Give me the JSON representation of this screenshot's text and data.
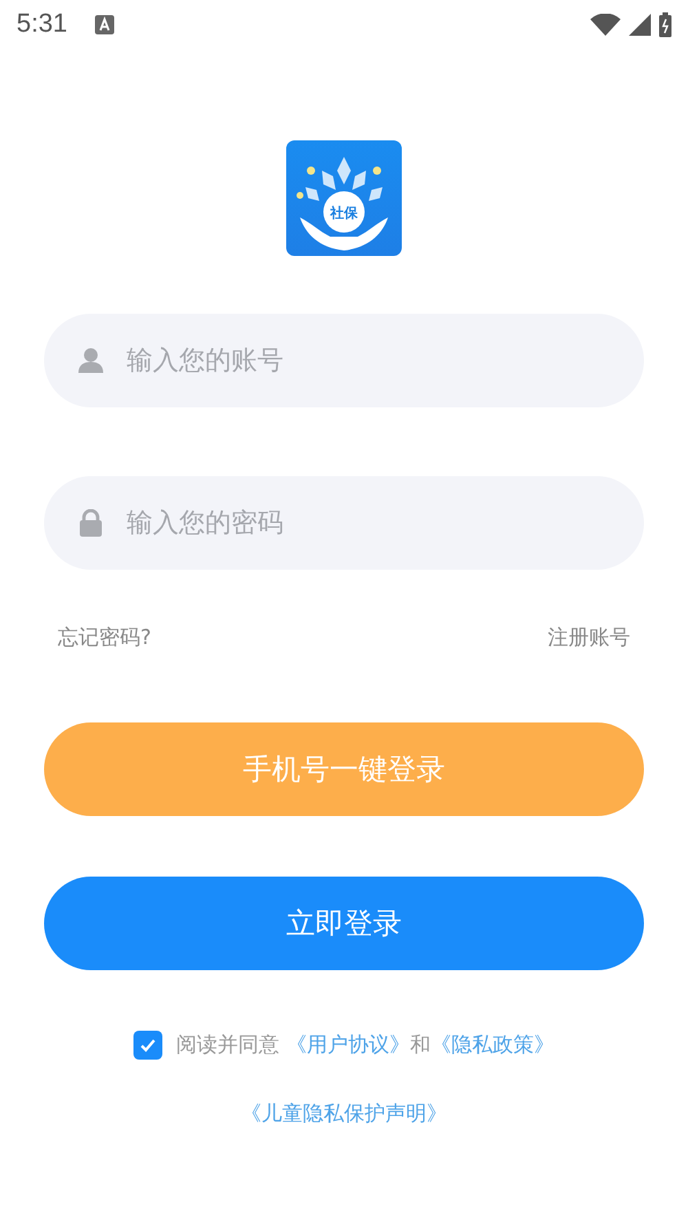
{
  "status_bar": {
    "time": "5:31"
  },
  "logo": {
    "text": "社保"
  },
  "fields": [
    {
      "kind": "user",
      "placeholder": "输入您的账号"
    },
    {
      "kind": "lock",
      "placeholder": "输入您的密码"
    }
  ],
  "links": {
    "forgot": "忘记密码?",
    "register": "注册账号"
  },
  "buttons": [
    {
      "kind": "phone",
      "label": "手机号一键登录"
    },
    {
      "kind": "login",
      "label": "立即登录"
    }
  ],
  "agreement": {
    "checked": true,
    "prefix": "阅读并同意 ",
    "user_agreement": "《用户协议》",
    "joiner": "和",
    "privacy": "《隐私政策》",
    "children_statement": "《儿童隐私保护声明》"
  }
}
